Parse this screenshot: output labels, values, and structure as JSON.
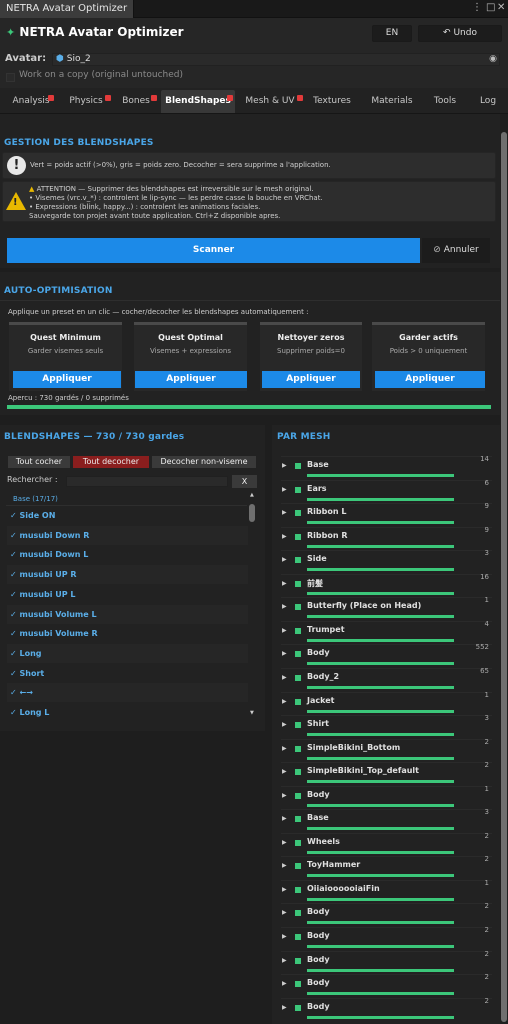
{
  "window": {
    "tab_title": "NETRA Avatar Optimizer",
    "menu_icon": "more-vert-icon",
    "close_icon": "close-icon"
  },
  "header": {
    "title": "NETRA Avatar Optimizer",
    "lang_button": "EN",
    "undo_button": "Undo",
    "logo_icon": "figure-icon",
    "undo_icon": "undo-icon"
  },
  "avatar": {
    "label": "Avatar:",
    "value": "Sio_2",
    "picker_icon": "target-icon"
  },
  "copy_option": {
    "label": "Work on a copy (original untouched)",
    "checked": false
  },
  "tabs": [
    {
      "label": "Analysis",
      "badge": true,
      "active": false
    },
    {
      "label": "Physics",
      "badge": true,
      "active": false
    },
    {
      "label": "Bones",
      "badge": true,
      "active": false
    },
    {
      "label": "BlendShapes",
      "badge": true,
      "active": true
    },
    {
      "label": "Mesh & UV",
      "badge": true,
      "active": false
    },
    {
      "label": "Textures",
      "badge": false,
      "active": false
    },
    {
      "label": "Materials",
      "badge": false,
      "active": false
    },
    {
      "label": "Tools",
      "badge": false,
      "active": false
    },
    {
      "label": "Log",
      "badge": false,
      "active": false
    }
  ],
  "gestion": {
    "title": "GESTION DES BLENDSHAPES",
    "info": "Vert = poids actif (>0%), gris = poids zero. Decocher = sera supprime a l'application.",
    "warning_lines": [
      "ATTENTION — Supprimer des blendshapes est irreversible sur le mesh original.",
      "• Visemes (vrc.v_*) : controlent le lip-sync — les perdre casse la bouche en VRChat.",
      "• Expressions (blink, happy...) : controlent les animations faciales.",
      "Sauvegarde ton projet avant toute application. Ctrl+Z disponible apres."
    ],
    "scan_button": "Scanner",
    "cancel_button": "Annuler",
    "cancel_icon": "cancel-icon"
  },
  "auto": {
    "title": "AUTO-OPTIMISATION",
    "description": "Applique un preset en un clic — cocher/decocher les blendshapes automatiquement :",
    "presets": [
      {
        "title": "Quest Minimum",
        "subtitle": "Garder visemes seuls",
        "button": "Appliquer"
      },
      {
        "title": "Quest Optimal",
        "subtitle": "Visemes + expressions",
        "button": "Appliquer"
      },
      {
        "title": "Nettoyer zeros",
        "subtitle": "Supprimer poids=0",
        "button": "Appliquer"
      },
      {
        "title": "Garder actifs",
        "subtitle": "Poids > 0 uniquement",
        "button": "Appliquer"
      }
    ],
    "preview": "Apercu : 730 gardés / 0 supprimés",
    "preview_fraction": 1.0
  },
  "blendshapes": {
    "title": "BLENDSHAPES — 730 / 730 gardes",
    "check_all": "Tout cocher",
    "uncheck_all": "Tout decocher",
    "uncheck_non_viseme": "Decocher non-viseme",
    "search_label": "Rechercher :",
    "search_value": "",
    "clear_button": "X",
    "group_label": "Base (17/17)",
    "items": [
      "✓ Side ON",
      "✓ musubi Down R",
      "✓ musubi Down L",
      "✓ musubi UP R",
      "✓ musubi UP L",
      "✓ musubi Volume L",
      "✓ musubi Volume R",
      "✓ Long",
      "✓ Short",
      "✓ ←→",
      "✓ Long L"
    ]
  },
  "par_mesh": {
    "title": "PAR MESH",
    "meshes": [
      {
        "name": "Base",
        "count": "14"
      },
      {
        "name": "Ears",
        "count": "6"
      },
      {
        "name": "Ribbon L",
        "count": "9"
      },
      {
        "name": "Ribbon R",
        "count": "9"
      },
      {
        "name": "Side",
        "count": "3"
      },
      {
        "name": "前髪",
        "count": "16"
      },
      {
        "name": "Butterfly (Place on Head)",
        "count": "1"
      },
      {
        "name": "Trumpet",
        "count": "4"
      },
      {
        "name": "Body",
        "count": "552"
      },
      {
        "name": "Body_2",
        "count": "65"
      },
      {
        "name": "Jacket",
        "count": "1"
      },
      {
        "name": "Shirt",
        "count": "3"
      },
      {
        "name": "SimpleBikini_Bottom",
        "count": "2"
      },
      {
        "name": "SimpleBikini_Top_default",
        "count": "2"
      },
      {
        "name": "Body",
        "count": "1"
      },
      {
        "name": "Base",
        "count": "3"
      },
      {
        "name": "Wheels",
        "count": "2"
      },
      {
        "name": "ToyHammer",
        "count": "2"
      },
      {
        "name": "OiiaioooooiaiFin",
        "count": "1"
      },
      {
        "name": "Body",
        "count": "2"
      },
      {
        "name": "Body",
        "count": "2"
      },
      {
        "name": "Body",
        "count": "2"
      },
      {
        "name": "Body",
        "count": "2"
      },
      {
        "name": "Body",
        "count": "2"
      }
    ]
  },
  "colors": {
    "accent_blue": "#1c8ae8",
    "section_title": "#4aa6e8",
    "active_green": "#3cc77a",
    "danger_red": "#8a1e1e",
    "badge_red": "#e23a3a"
  }
}
